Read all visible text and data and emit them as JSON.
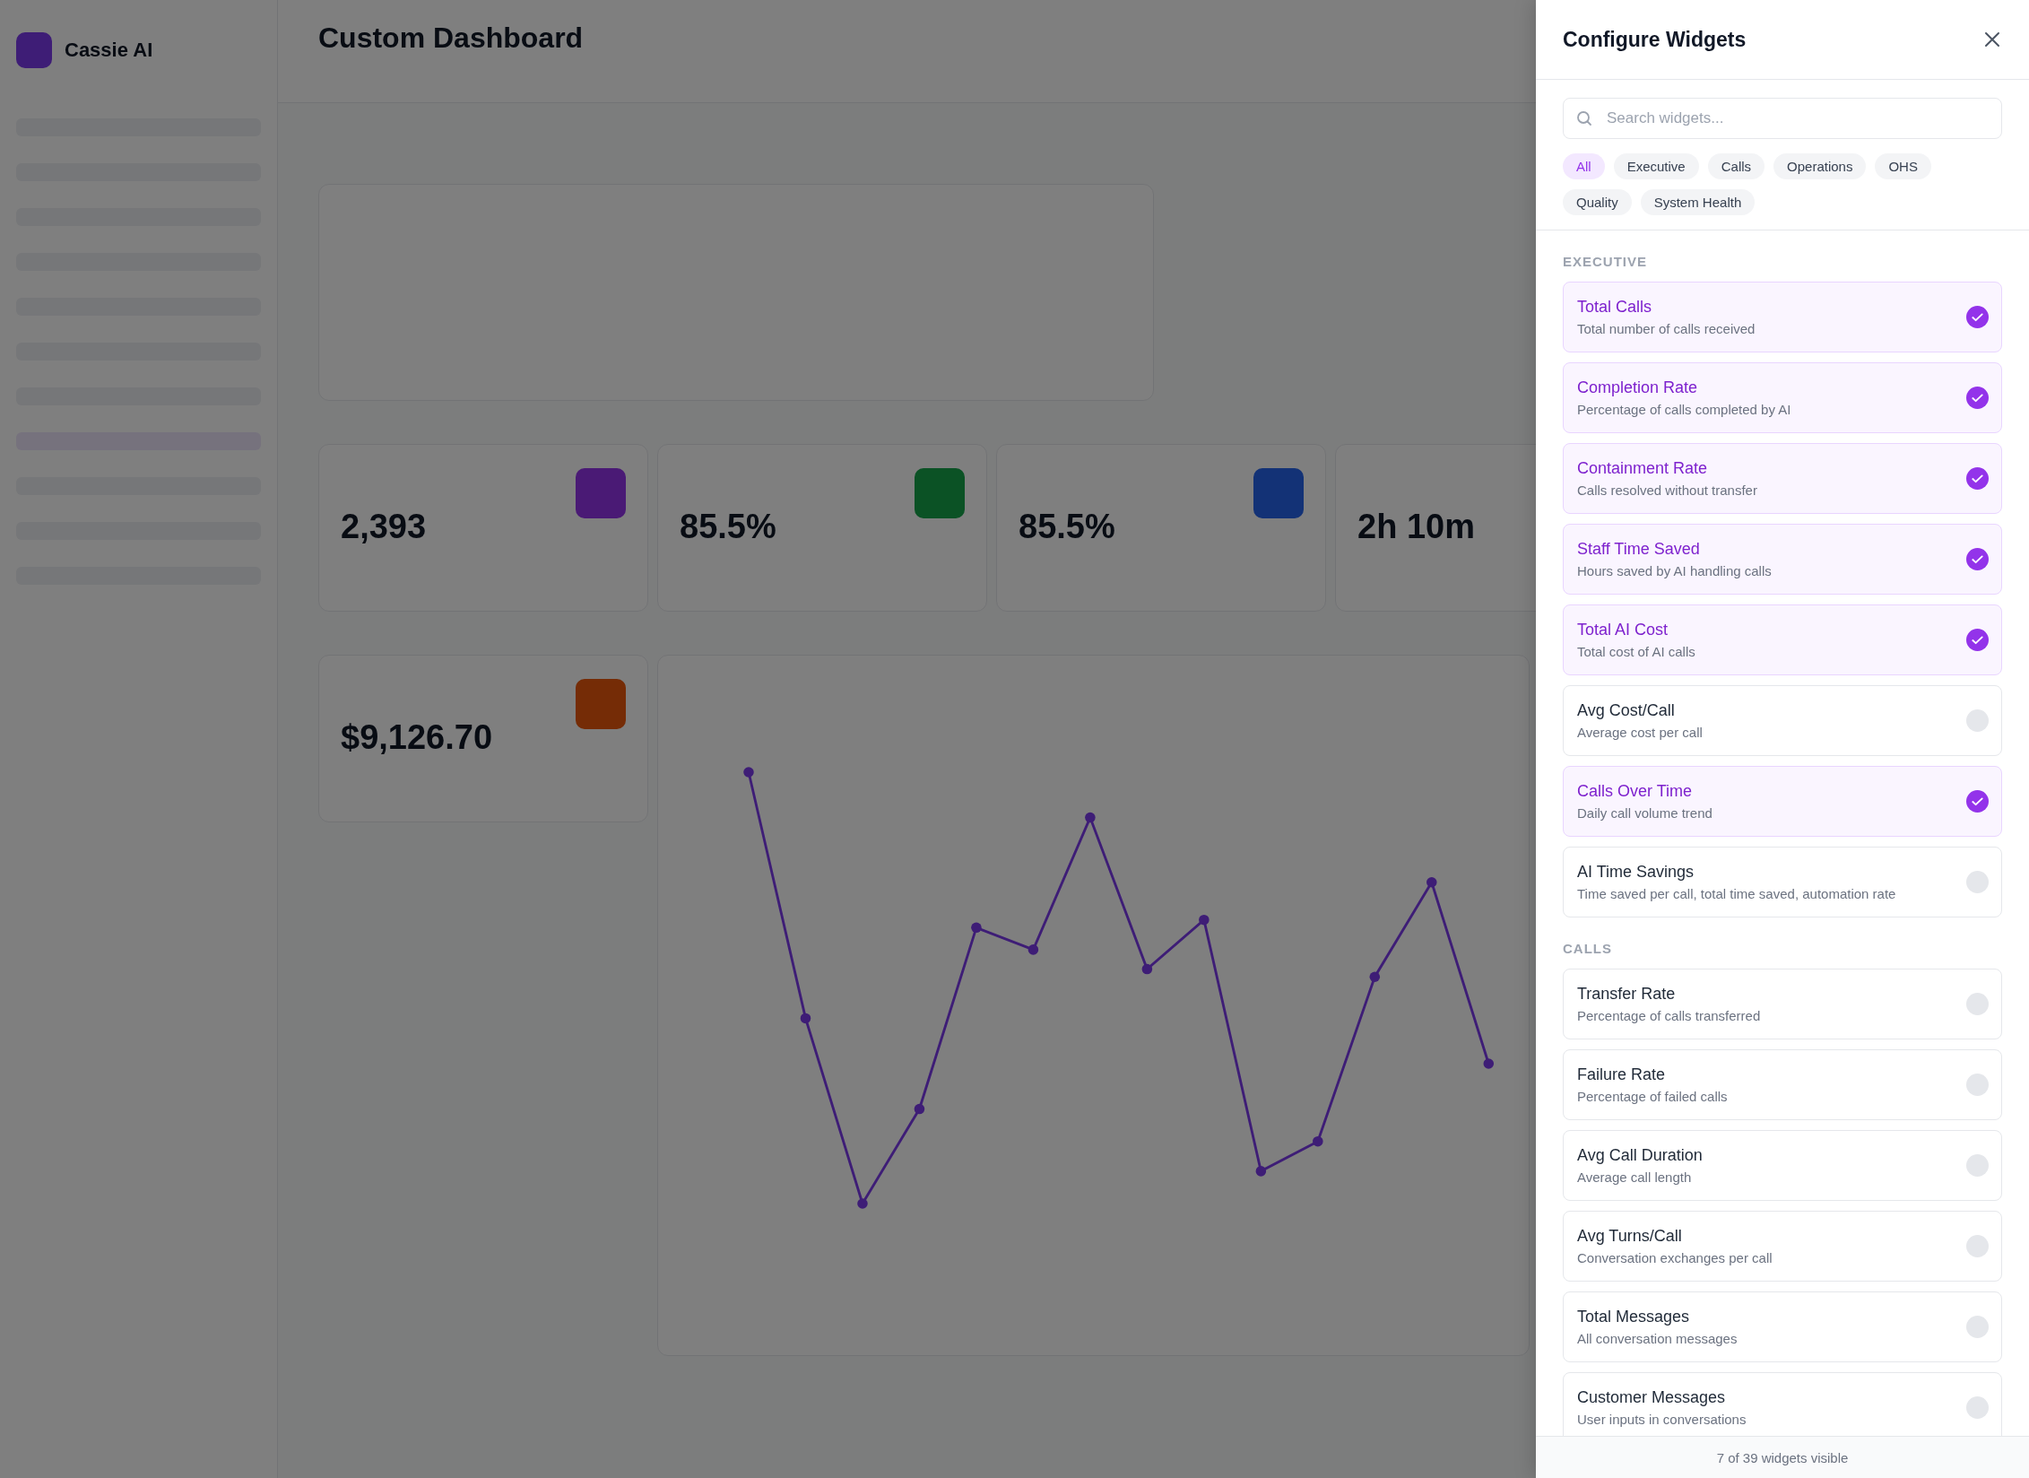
{
  "backdrop": {
    "brand": "Cassie AI",
    "title": "Custom Dashboard",
    "stats": [
      {
        "value": "2,393",
        "color": "#4a1a75"
      },
      {
        "value": "85.5%",
        "color": "#0b5225"
      },
      {
        "value": "85.5%",
        "color": "#133276"
      },
      {
        "value": "2h 10m"
      },
      {
        "value": "$9,126.70",
        "color": "#752c06"
      }
    ]
  },
  "panel": {
    "title": "Configure Widgets",
    "search": {
      "placeholder": "Search widgets..."
    },
    "filters": [
      {
        "label": "All",
        "selected": true
      },
      {
        "label": "Executive",
        "selected": false
      },
      {
        "label": "Calls",
        "selected": false
      },
      {
        "label": "Operations",
        "selected": false
      },
      {
        "label": "OHS",
        "selected": false
      },
      {
        "label": "Quality",
        "selected": false
      },
      {
        "label": "System Health",
        "selected": false
      }
    ],
    "sections": [
      {
        "heading": "EXECUTIVE",
        "widgets": [
          {
            "title": "Total Calls",
            "description": "Total number of calls received",
            "checked": true
          },
          {
            "title": "Completion Rate",
            "description": "Percentage of calls completed by AI",
            "checked": true
          },
          {
            "title": "Containment Rate",
            "description": "Calls resolved without transfer",
            "checked": true
          },
          {
            "title": "Staff Time Saved",
            "description": "Hours saved by AI handling calls",
            "checked": true
          },
          {
            "title": "Total AI Cost",
            "description": "Total cost of AI calls",
            "checked": true
          },
          {
            "title": "Avg Cost/Call",
            "description": "Average cost per call",
            "checked": false
          },
          {
            "title": "Calls Over Time",
            "description": "Daily call volume trend",
            "checked": true
          },
          {
            "title": "AI Time Savings",
            "description": "Time saved per call, total time saved, automation rate",
            "checked": false
          }
        ]
      },
      {
        "heading": "CALLS",
        "widgets": [
          {
            "title": "Transfer Rate",
            "description": "Percentage of calls transferred",
            "checked": false
          },
          {
            "title": "Failure Rate",
            "description": "Percentage of failed calls",
            "checked": false
          },
          {
            "title": "Avg Call Duration",
            "description": "Average call length",
            "checked": false
          },
          {
            "title": "Avg Turns/Call",
            "description": "Conversation exchanges per call",
            "checked": false
          },
          {
            "title": "Total Messages",
            "description": "All conversation messages",
            "checked": false
          },
          {
            "title": "Customer Messages",
            "description": "User inputs in conversations",
            "checked": false
          }
        ]
      }
    ],
    "footer": "7 of 39 widgets visible"
  }
}
